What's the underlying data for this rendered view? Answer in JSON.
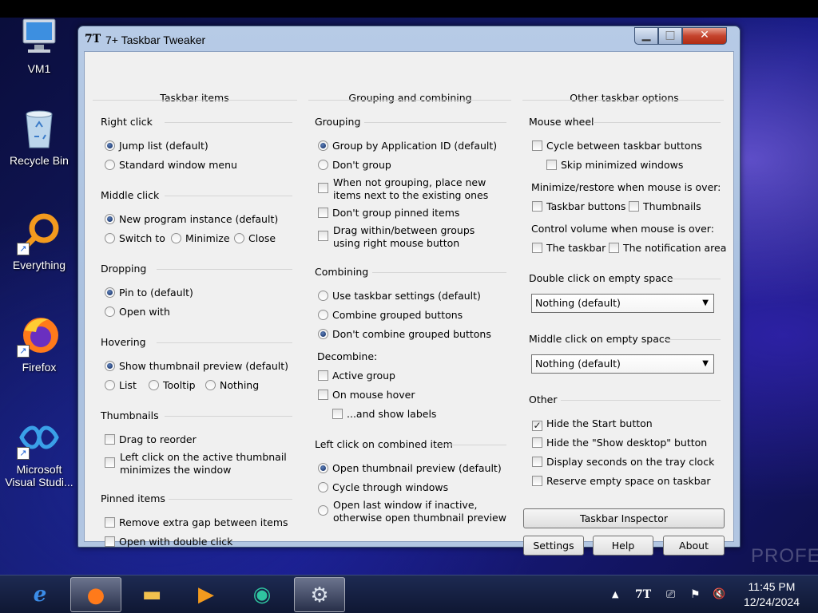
{
  "desktop": {
    "icons": [
      {
        "label": "VM1",
        "icon": "computer-icon"
      },
      {
        "label": "Recycle Bin",
        "icon": "recycle-bin-icon"
      },
      {
        "label": "Everything",
        "icon": "everything-search-icon"
      },
      {
        "label": "Firefox",
        "icon": "firefox-icon"
      },
      {
        "label": "Microsoft Visual Studi...",
        "icon": "visual-studio-icon"
      }
    ],
    "watermark": "PROFE"
  },
  "window": {
    "title": "7+ Taskbar Tweaker",
    "icon_text": "7T",
    "controls": {
      "minimize": "▁",
      "maximize": "□",
      "close": "✕"
    }
  },
  "columns": {
    "taskbar_items": {
      "heading": "Taskbar items",
      "right_click": {
        "title": "Right click",
        "options": [
          "Jump list (default)",
          "Standard window menu"
        ],
        "selected": 0
      },
      "middle_click": {
        "title": "Middle click",
        "options": [
          "New program instance (default)",
          "Switch to",
          "Minimize",
          "Close"
        ],
        "selected": 0
      },
      "dropping": {
        "title": "Dropping",
        "options": [
          "Pin to (default)",
          "Open with"
        ],
        "selected": 0
      },
      "hovering": {
        "title": "Hovering",
        "options": [
          "Show thumbnail preview (default)",
          "List",
          "Tooltip",
          "Nothing"
        ],
        "selected": 0
      },
      "thumbnails": {
        "title": "Thumbnails",
        "options": [
          "Drag to reorder",
          "Left click on the active thumbnail minimizes the window"
        ],
        "checked": [
          false,
          false
        ]
      },
      "pinned_items": {
        "title": "Pinned items",
        "options": [
          "Remove extra gap between items",
          "Open with double click"
        ],
        "checked": [
          false,
          false
        ]
      }
    },
    "grouping_combining": {
      "heading": "Grouping and combining",
      "grouping": {
        "title": "Grouping",
        "radios": [
          "Group by Application ID (default)",
          "Don't group"
        ],
        "selected": 0,
        "checks": [
          "When not grouping, place new items next to the existing ones",
          "Don't group pinned items",
          "Drag within/between groups using right mouse button"
        ],
        "checked": [
          false,
          false,
          false
        ]
      },
      "combining": {
        "title": "Combining",
        "radios": [
          "Use taskbar settings (default)",
          "Combine grouped buttons",
          "Don't combine grouped buttons"
        ],
        "selected": 2,
        "decombine_label": "Decombine:",
        "checks": [
          "Active group",
          "On mouse hover",
          "...and show labels"
        ],
        "checked": [
          false,
          false,
          false
        ]
      },
      "left_click_combined": {
        "title": "Left click on combined item",
        "radios": [
          "Open thumbnail preview (default)",
          "Cycle through windows",
          "Open last window if inactive, otherwise open thumbnail preview"
        ],
        "selected": 0
      }
    },
    "other_options": {
      "heading": "Other taskbar options",
      "mouse_wheel": {
        "title": "Mouse wheel",
        "checks": [
          "Cycle between taskbar buttons",
          "Skip minimized windows"
        ],
        "checked": [
          false,
          false
        ],
        "minimize_label": "Minimize/restore when mouse is over:",
        "minimize_checks": [
          "Taskbar buttons",
          "Thumbnails"
        ],
        "minimize_checked": [
          false,
          false
        ],
        "volume_label": "Control volume when mouse is over:",
        "volume_checks": [
          "The taskbar",
          "The notification area"
        ],
        "volume_checked": [
          false,
          false
        ]
      },
      "double_click_empty": {
        "title": "Double click on empty space",
        "value": "Nothing (default)"
      },
      "middle_click_empty": {
        "title": "Middle click on empty space",
        "value": "Nothing (default)"
      },
      "other": {
        "title": "Other",
        "checks": [
          "Hide the Start button",
          "Hide the \"Show desktop\" button",
          "Display seconds on the tray clock",
          "Reserve empty space on taskbar"
        ],
        "checked": [
          true,
          false,
          false,
          false
        ]
      },
      "buttons": {
        "inspector": "Taskbar Inspector",
        "settings": "Settings",
        "help": "Help",
        "about": "About"
      }
    }
  },
  "taskbar": {
    "items": [
      {
        "icon": "internet-explorer-icon",
        "glyph": "e",
        "active": false
      },
      {
        "icon": "firefox-icon",
        "glyph": "●",
        "active": true
      },
      {
        "icon": "file-explorer-icon",
        "glyph": "▬",
        "active": false
      },
      {
        "icon": "media-player-icon",
        "glyph": "▶",
        "active": false
      },
      {
        "icon": "app-icon",
        "glyph": "◉",
        "active": false
      },
      {
        "icon": "taskbar-tweaker-icon",
        "glyph": "⚙",
        "active": true
      }
    ],
    "tray": {
      "show_hidden": "▲",
      "tweaker": "7T",
      "network": "⎚",
      "flag": "⚑",
      "volume": "🔇"
    },
    "clock": {
      "time": "11:45 PM",
      "date": "12/24/2024"
    }
  }
}
